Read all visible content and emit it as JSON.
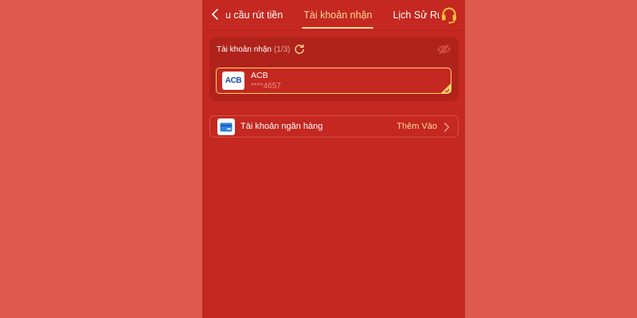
{
  "header": {
    "tabs": [
      {
        "label": "u cầu rút tiền",
        "active": false
      },
      {
        "label": "Tài khoản nhận",
        "active": true
      },
      {
        "label": "Lịch Sử Rút T",
        "active": false
      }
    ],
    "back_icon": "chevron-left-icon",
    "support_icon": "headset-icon"
  },
  "receive_card": {
    "title": "Tài khoản nhận",
    "count": "(1/3)",
    "refresh_icon": "refresh-icon",
    "visibility_icon": "eye-off-icon",
    "accounts": [
      {
        "bank": "ACB",
        "logo_text": "ACB",
        "number": "****4657",
        "selected": true
      }
    ]
  },
  "bank_row": {
    "label": "Tài khoản ngân hàng",
    "action": "Thêm Vào",
    "icon": "bank-card-icon"
  },
  "colors": {
    "background": "#de5a4c",
    "panel": "#c42820",
    "card": "#b0231b",
    "accent": "#ffd89a",
    "highlight_border": "#ffd36e"
  }
}
